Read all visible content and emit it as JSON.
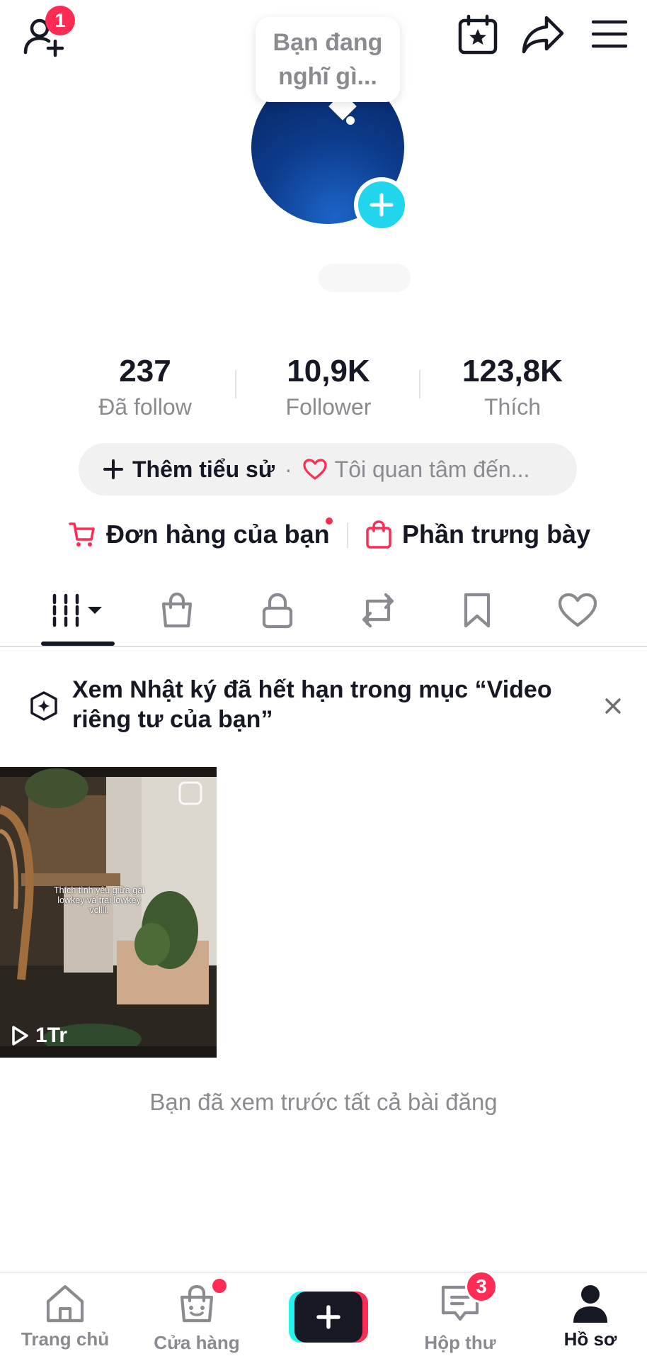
{
  "header": {
    "friend_badge": "1",
    "tooltip_text": "Bạn đang nghĩ gì...",
    "icons": [
      "add-friend-icon",
      "calendar-star-icon",
      "share-icon",
      "menu-icon"
    ]
  },
  "stats": [
    {
      "value": "237",
      "label": "Đã follow"
    },
    {
      "value": "10,9K",
      "label": "Follower"
    },
    {
      "value": "123,8K",
      "label": "Thích"
    }
  ],
  "bio": {
    "add_label": "Thêm tiểu sử",
    "separator": "·",
    "interest_label": "Tôi quan tâm đến..."
  },
  "shop": {
    "orders_label": "Đơn hàng của bạn",
    "showcase_label": "Phần trưng bày"
  },
  "tabs": [
    "videos-grid-icon",
    "shop-bag-icon",
    "lock-icon",
    "repost-icon",
    "bookmark-icon",
    "heart-icon"
  ],
  "notice": {
    "text": "Xem Nhật ký đã hết hạn trong mục “Video riêng tư của bạn”"
  },
  "videos": [
    {
      "caption": "Thích tình yêu giữa gái lowkey và trai lowkey vcllll.",
      "views": "1Tr"
    }
  ],
  "end_message": "Bạn đã xem trước tất cả bài đăng",
  "nav": {
    "items": [
      {
        "label": "Trang chủ",
        "icon": "home-icon"
      },
      {
        "label": "Cửa hàng",
        "icon": "shop-icon"
      },
      {
        "label": "",
        "icon": "create-icon"
      },
      {
        "label": "Hộp thư",
        "icon": "inbox-icon",
        "badge": "3"
      },
      {
        "label": "Hồ sơ",
        "icon": "profile-icon",
        "active": true
      }
    ]
  },
  "colors": {
    "accent": "#fe2c55",
    "cyan": "#20d5ec",
    "text": "#161823",
    "muted": "#8a8b91"
  }
}
